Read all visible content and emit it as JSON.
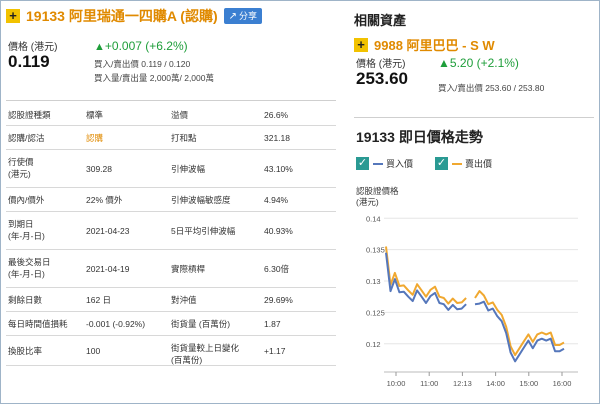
{
  "warrant": {
    "plus": "+",
    "title": "19133 阿里瑞通一四購A (認購)",
    "share_label": "分享",
    "price_label": "價格 (港元)",
    "price": "0.119",
    "change": "+0.007 (+6.2%)",
    "bidask": "買入/賣出價 0.119 / 0.120",
    "bidask_vol": "買入量/賣出量 2,000萬/ 2,000萬"
  },
  "table": [
    [
      "認股證種類",
      "標準",
      "溢價",
      "26.6%"
    ],
    [
      "認購/認沽",
      "認購",
      "打和點",
      "321.18"
    ],
    [
      "行使價\n(港元)",
      "309.28",
      "引伸波幅",
      "43.10%"
    ],
    [
      "價內/價外",
      "22% 價外",
      "引伸波幅敏感度",
      "4.94%"
    ],
    [
      "到期日\n(年-月-日)",
      "2021-04-23",
      "5日平均引伸波幅",
      "40.93%"
    ],
    [
      "最後交易日\n(年-月-日)",
      "2021-04-19",
      "實際槓桿",
      "6.30倍"
    ],
    [
      "剩餘日數",
      "162 日",
      "對沖值",
      "29.69%"
    ],
    [
      "每日時間值損耗",
      "-0.001 (-0.92%)",
      "街貨量 (百萬份)",
      "1.87"
    ],
    [
      "換股比率",
      "100",
      "街貨量較上日變化\n(百萬份)",
      "+1.17"
    ]
  ],
  "related": {
    "title": "相關資產",
    "plus": "+",
    "stock": "9988 阿里巴巴 - S W",
    "price_label": "價格 (港元)",
    "price": "253.60",
    "change": "5.20 (+2.1%)",
    "bidask": "買入/賣出價 253.60 / 253.80"
  },
  "chart": {
    "title": "19133 即日價格走勢",
    "check": "✓",
    "legend_bid": "買入價",
    "legend_ask": "賣出價"
  },
  "colors": {
    "bid": "#5577bb",
    "ask": "#f0a830",
    "accent": "#e08a00",
    "up": "#1e9e3a"
  },
  "chart_data": {
    "type": "line",
    "ylabel": "認股證價格\n(港元)",
    "ylim": [
      0.1155,
      0.141
    ],
    "yticks": [
      0.14,
      0.135,
      0.13,
      0.125,
      0.12
    ],
    "xticks": [
      "10:00",
      "11:00",
      "12:13",
      "14:00",
      "15:00",
      "16:00"
    ],
    "series": [
      {
        "name": "買入價",
        "color": "#5577bb",
        "values": [
          0.1345,
          0.1284,
          0.1303,
          0.1282,
          0.1283,
          0.1275,
          0.1268,
          0.1285,
          0.1275,
          0.1265,
          0.1276,
          0.1281,
          0.1265,
          0.1263,
          0.1254,
          0.1262,
          0.1255,
          0.1256,
          0.1263,
          null,
          0.1263,
          0.1264,
          0.1267,
          0.1253,
          0.1256,
          0.1244,
          0.1236,
          0.1217,
          0.1186,
          0.1172,
          0.1183,
          0.1194,
          0.1205,
          0.1193,
          0.1205,
          0.1208,
          0.1205,
          0.1208,
          0.1188,
          0.1188,
          0.1192
        ]
      },
      {
        "name": "賣出價",
        "color": "#f0a830",
        "values": [
          0.1355,
          0.1294,
          0.1313,
          0.1292,
          0.1293,
          0.1285,
          0.1278,
          0.1295,
          0.1285,
          0.1275,
          0.1286,
          0.1291,
          0.1275,
          0.1273,
          0.1264,
          0.1272,
          0.1265,
          0.1266,
          0.1273,
          null,
          0.1273,
          0.1284,
          0.1277,
          0.1263,
          0.1266,
          0.1254,
          0.1246,
          0.1227,
          0.1196,
          0.1182,
          0.1193,
          0.1204,
          0.1215,
          0.1203,
          0.1215,
          0.1218,
          0.1215,
          0.1218,
          0.1198,
          0.1198,
          0.1202
        ]
      }
    ]
  }
}
